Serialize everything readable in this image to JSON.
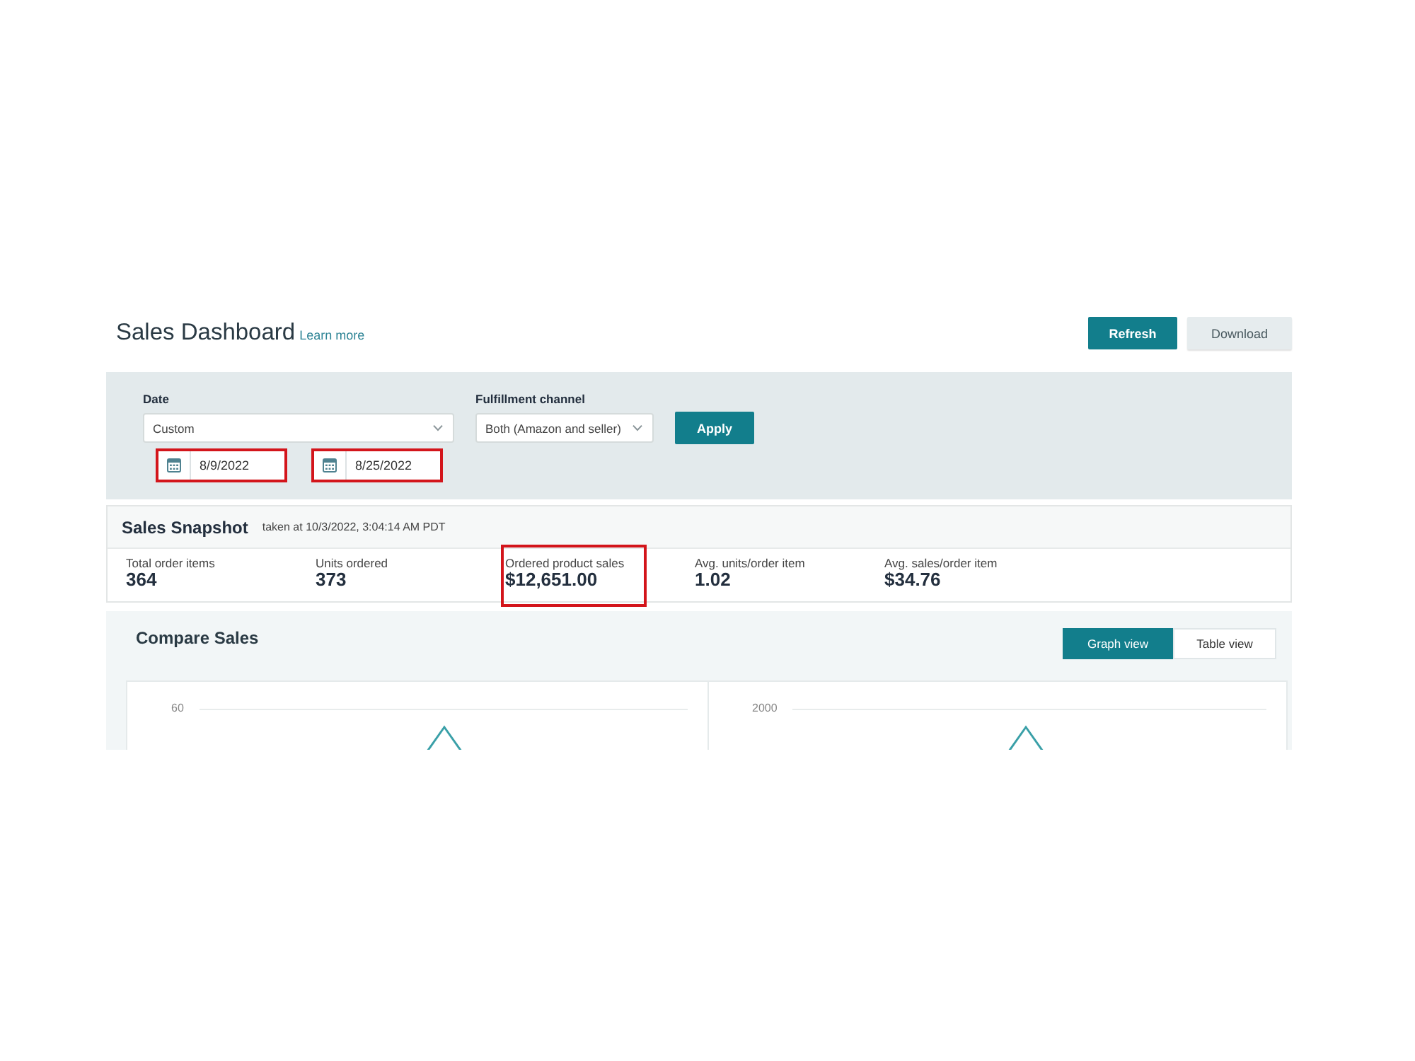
{
  "header": {
    "title": "Sales Dashboard",
    "link": "Learn more",
    "buttons": [
      {
        "label": "Refresh",
        "kind": "primary"
      },
      {
        "label": "Download",
        "kind": "secondary"
      }
    ]
  },
  "filters": {
    "fields": [
      {
        "label": "Date",
        "value": "Custom"
      },
      {
        "label": "Fulfillment channel",
        "value": "Both (Amazon and seller)"
      }
    ],
    "date_range": [
      {
        "value": "8/9/2022",
        "highlighted": true
      },
      {
        "value": "8/25/2022",
        "highlighted": true
      }
    ],
    "apply_button": "Apply"
  },
  "snapshot": {
    "title": "Sales Snapshot",
    "timestamp": "taken at 10/3/2022, 3:04:14 AM PDT",
    "metrics": [
      {
        "label": "Total order items",
        "value": "364",
        "highlighted": false
      },
      {
        "label": "Units ordered",
        "value": "373",
        "highlighted": false
      },
      {
        "label": "Ordered product sales",
        "value": "$12,651.00",
        "highlighted": true
      },
      {
        "label": "Avg. units/order item",
        "value": "1.02",
        "highlighted": false
      },
      {
        "label": "Avg. sales/order item",
        "value": "$34.76",
        "highlighted": false
      }
    ]
  },
  "compare_sales": {
    "title": "Compare Sales",
    "view_toggle": [
      {
        "label": "Graph view",
        "selected": true
      },
      {
        "label": "Table view",
        "selected": false
      }
    ],
    "charts": [
      {
        "tick_label": "60"
      },
      {
        "tick_label": "2000"
      }
    ]
  }
}
